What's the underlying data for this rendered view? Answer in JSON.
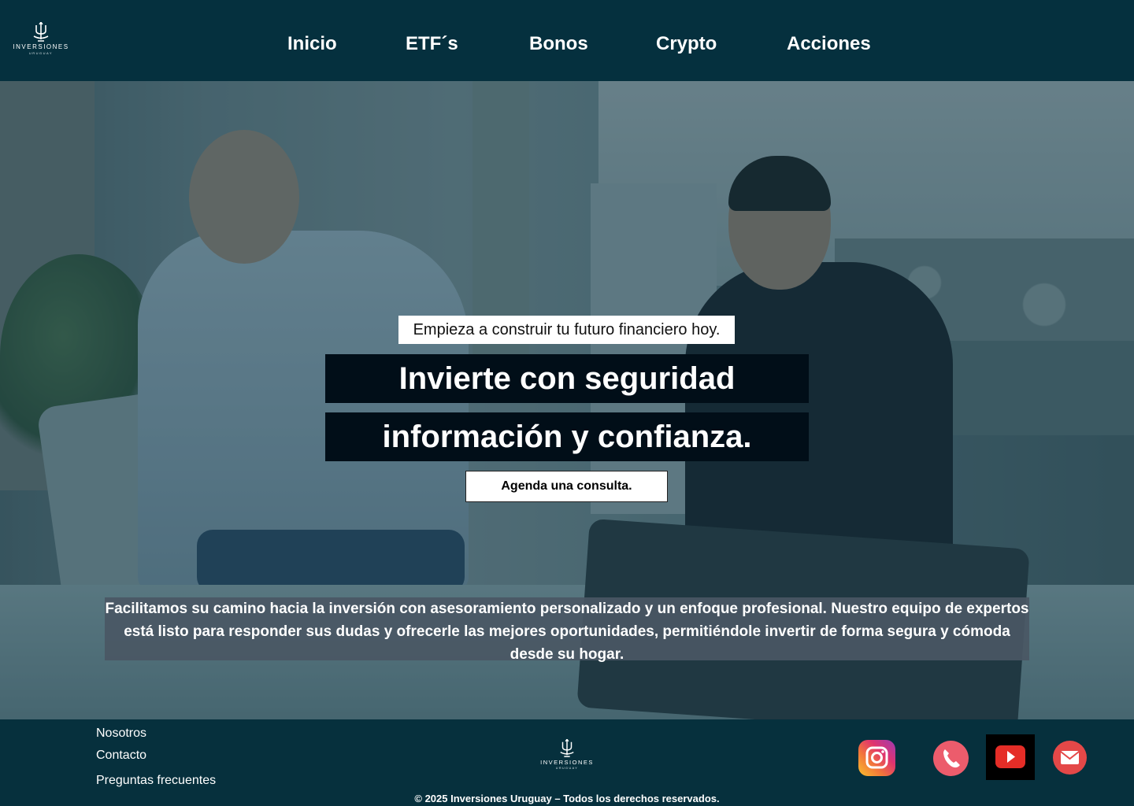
{
  "header": {
    "logo": {
      "brand": "INVERSIONES",
      "sub": "URUGUAY"
    },
    "nav": [
      {
        "label": "Inicio"
      },
      {
        "label": "ETF´s"
      },
      {
        "label": "Bonos"
      },
      {
        "label": "Crypto"
      },
      {
        "label": "Acciones"
      }
    ]
  },
  "hero": {
    "tagline": "Empieza a construir tu futuro financiero hoy.",
    "headline_line1": "Invierte con seguridad",
    "headline_line2": "información y confianza.",
    "cta": "Agenda una consulta.",
    "description": "Facilitamos su camino hacia la inversión con asesoramiento personalizado y un enfoque profesional. Nuestro equipo de expertos está listo para responder sus dudas y ofrecerle las mejores oportunidades, permitiéndole invertir de forma segura y cómoda desde su hogar."
  },
  "footer": {
    "links": [
      {
        "label": "Nosotros"
      },
      {
        "label": "Contacto"
      },
      {
        "label": "Preguntas frecuentes"
      }
    ],
    "logo": {
      "brand": "INVERSIONES",
      "sub": "URUGUAY"
    },
    "copyright": "© 2025 Inversiones Uruguay – Todos los derechos reservados.",
    "social": [
      {
        "icon": "instagram-icon"
      },
      {
        "icon": "phone-icon"
      },
      {
        "icon": "youtube-icon"
      },
      {
        "icon": "mail-icon"
      }
    ]
  },
  "colors": {
    "navbar": "#05303e",
    "headline_bg": "#010e18",
    "description_bg": "#4a5764",
    "instagram": "#e0336f",
    "phone": "#ec5c6c",
    "youtube": "#e52d27",
    "mail": "#e44848"
  }
}
